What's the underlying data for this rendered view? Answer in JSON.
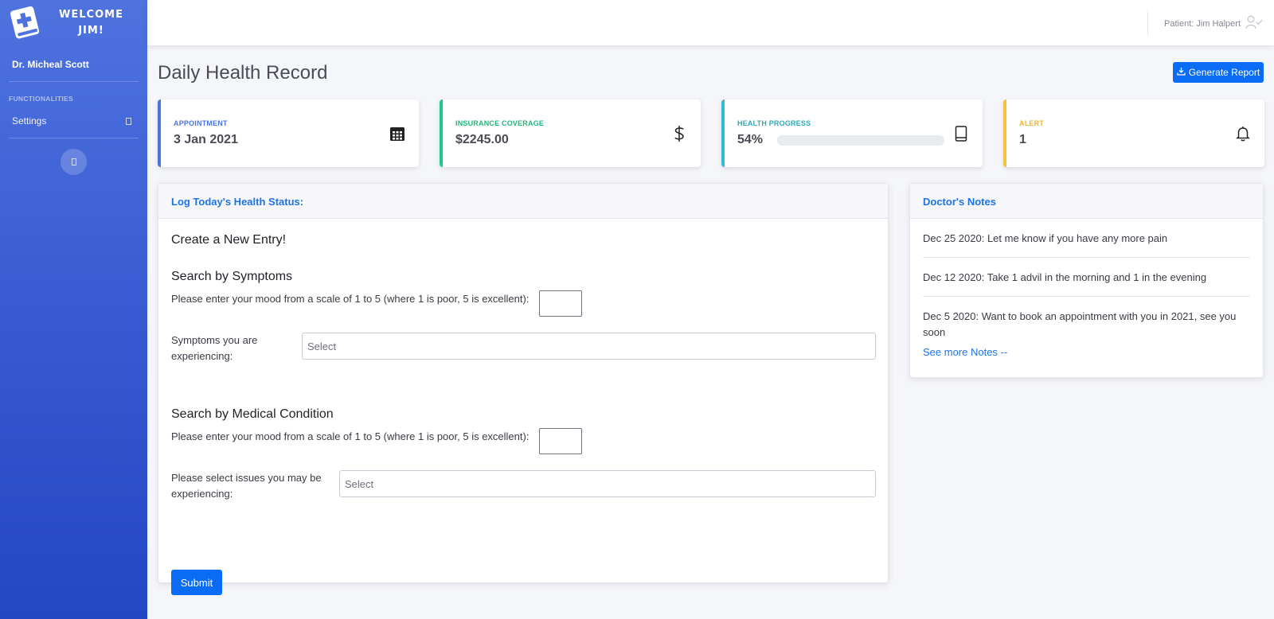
{
  "sidebar": {
    "welcome_line1": "WELCOME",
    "welcome_line2": "JIM!",
    "doctor": "Dr. Micheal Scott",
    "section_heading": "FUNCTIONALITIES",
    "items": [
      {
        "label": "Settings"
      }
    ]
  },
  "topbar": {
    "patient": "Patient: Jim Halpert"
  },
  "page": {
    "title": "Daily Health Record",
    "report_button": "Generate Report"
  },
  "cards": [
    {
      "label": "APPOINTMENT",
      "value": "3 Jan 2021",
      "color": "#4e73df",
      "icon": "calendar-icon"
    },
    {
      "label": "INSURANCE COVERAGE",
      "value": "$2245.00",
      "color": "#1cc88a",
      "icon": "dollar-icon"
    },
    {
      "label": "HEALTH PROGRESS",
      "value": "54%",
      "progress": 0.54,
      "color": "#36b9cc",
      "icon": "book-icon"
    },
    {
      "label": "ALERT",
      "value": "1",
      "color": "#f6c23e",
      "icon": "bell-icon"
    }
  ],
  "form": {
    "header": "Log Today's Health Status:",
    "entry_title": "Create a New Entry!",
    "symptoms": {
      "title": "Search by Symptoms",
      "mood_prompt": "Please enter your mood from a scale of 1 to 5 (where 1 is poor, 5 is excellent):",
      "select_label": "Symptoms you are experiencing:",
      "select_placeholder": "Select"
    },
    "condition": {
      "title": "Search by Medical Condition",
      "mood_prompt": "Please enter your mood from a scale of 1 to 5 (where 1 is poor, 5 is excellent):",
      "select_label": "Please select issues you may be experiencing:",
      "select_placeholder": "Select"
    },
    "submit": "Submit"
  },
  "notes": {
    "header": "Doctor's Notes",
    "items": [
      "Dec 25 2020: Let me know if you have any more pain",
      "Dec 12 2020: Take 1 advil in the morning and 1 in the evening",
      "Dec 5 2020: Want to book an appointment with you in 2021, see you soon"
    ],
    "see_more": "See more Notes --"
  }
}
